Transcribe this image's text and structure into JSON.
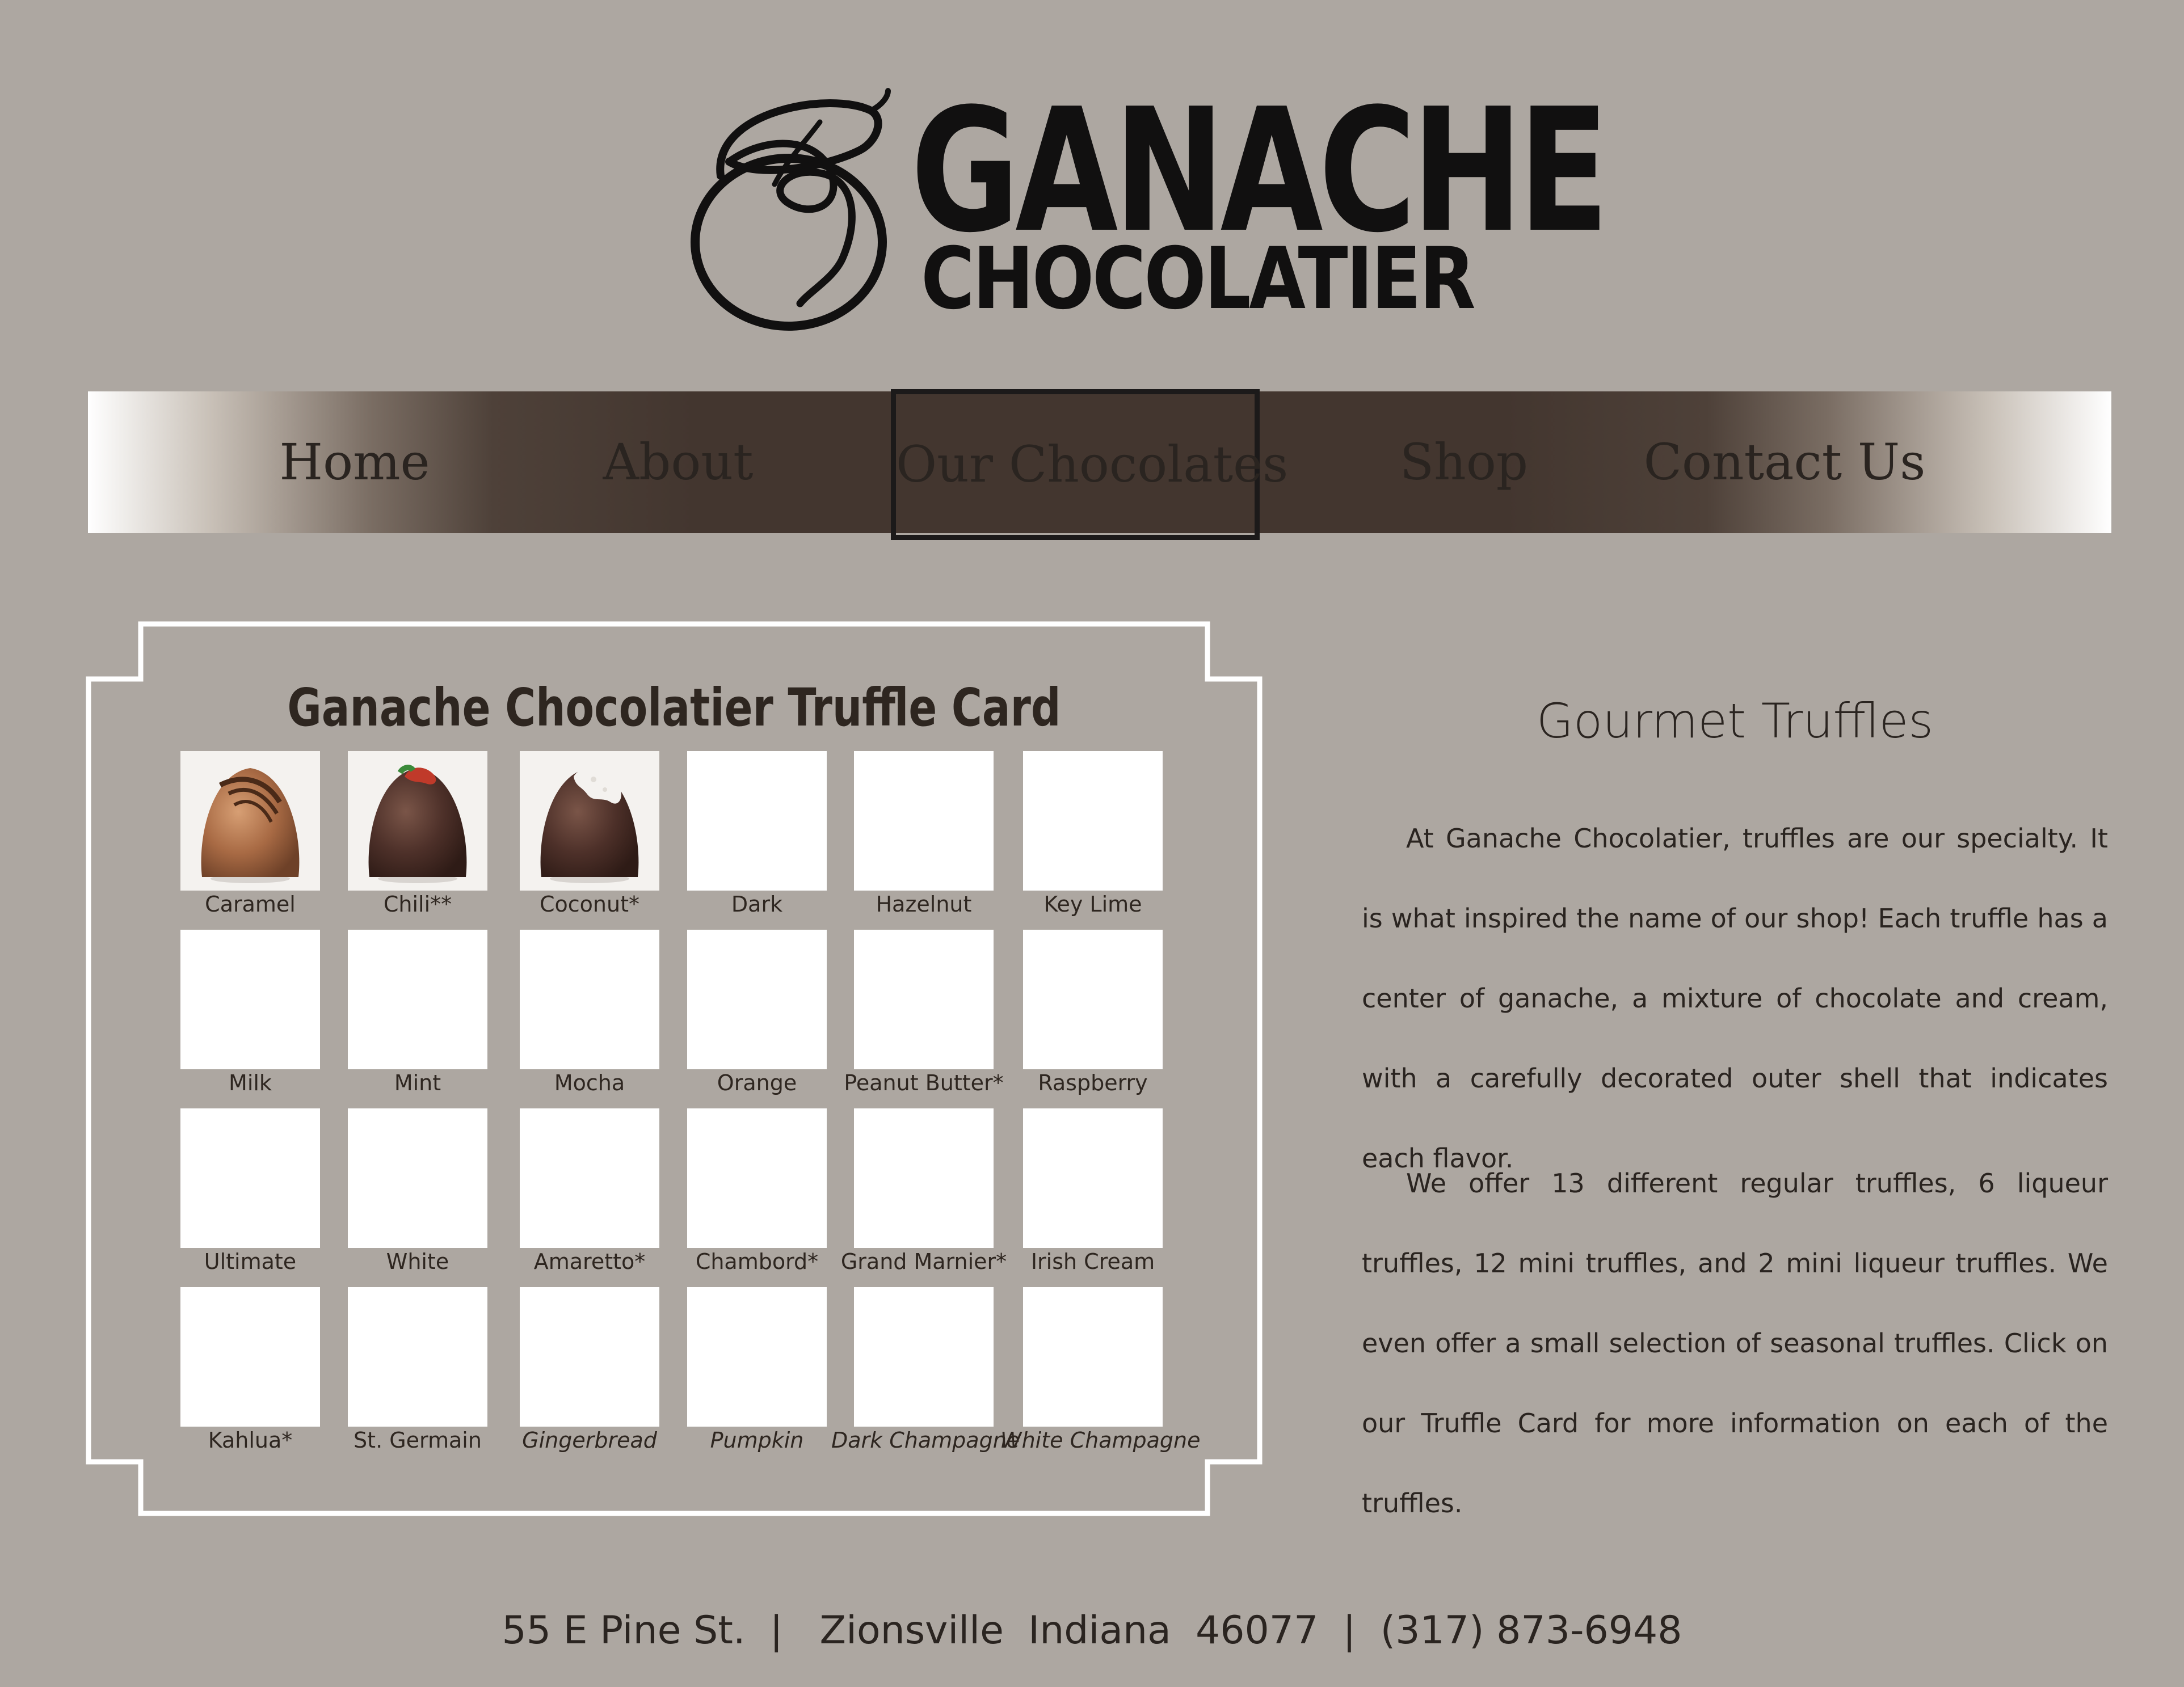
{
  "logo": {
    "title": "GANACHE",
    "subtitle": "CHOCOLATIER",
    "icon": "swirl-monogram-logo"
  },
  "nav": {
    "items": [
      {
        "label": "Home"
      },
      {
        "label": "About"
      },
      {
        "label": "Our Chocolates",
        "active": true
      },
      {
        "label": "Shop"
      },
      {
        "label": "Contact Us"
      }
    ]
  },
  "truffle_card": {
    "title": "Ganache Chocolatier Truffle Card",
    "items": [
      {
        "name": "Caramel",
        "image": "caramel-truffle-photo"
      },
      {
        "name": "Chili**",
        "image": "chili-truffle-photo"
      },
      {
        "name": "Coconut*",
        "image": "coconut-truffle-photo"
      },
      {
        "name": "Dark"
      },
      {
        "name": "Hazelnut"
      },
      {
        "name": "Key Lime"
      },
      {
        "name": "Milk"
      },
      {
        "name": "Mint"
      },
      {
        "name": "Mocha"
      },
      {
        "name": "Orange"
      },
      {
        "name": "Peanut Butter*"
      },
      {
        "name": "Raspberry"
      },
      {
        "name": "Ultimate"
      },
      {
        "name": "White"
      },
      {
        "name": "Amaretto*"
      },
      {
        "name": "Chambord*"
      },
      {
        "name": "Grand Marnier*"
      },
      {
        "name": "Irish Cream"
      },
      {
        "name": "Kahlua*"
      },
      {
        "name": "St. Germain"
      },
      {
        "name": "Gingerbread",
        "seasonal": true
      },
      {
        "name": "Pumpkin",
        "seasonal": true
      },
      {
        "name": "Dark Champagne",
        "seasonal": true
      },
      {
        "name": "White Champagne",
        "seasonal": true
      }
    ]
  },
  "content": {
    "heading": "Gourmet Truffles",
    "paragraph1": "At Ganache Chocolatier, truffles are our specialty. It is what inspired the name of our shop! Each truffle has a center of ganache, a mixture of chocolate and cream, with a carefully decorated outer shell that indicates each flavor.",
    "paragraph2": "We offer 13 different regular truffles, 6 liqueur truffles, 12 mini truffles, and 2 mini liqueur truffles. We even offer a small selection of seasonal truffles. Click on our Truffle Card for more information on each of the truffles."
  },
  "footer": {
    "text": "55 E Pine St.  |   Zionsville  Indiana  46077  |  (317) 873-6948"
  },
  "colors": {
    "background": "#ada7a1",
    "nav_dark": "#43362f",
    "text": "#2a2420",
    "card_border": "#ffffff"
  }
}
